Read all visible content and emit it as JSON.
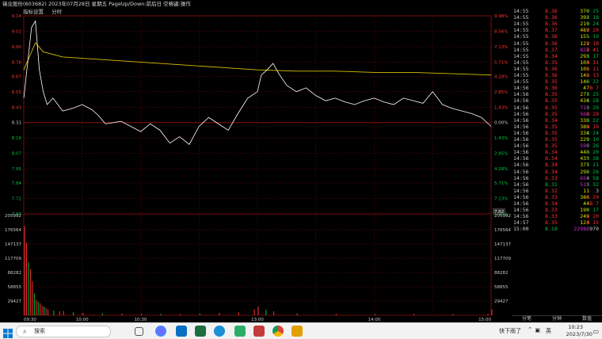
{
  "window": {
    "title": "锡业股份(603682)  2023年07月28日 星期五 PageUp/Down:前后日 空格键:操作"
  },
  "subbar": {
    "tab1": "指标设置",
    "tab2": "分时"
  },
  "colors": {
    "bg": "#000000",
    "up": "#ff3030",
    "down": "#00c040",
    "price_line": "#ffffff",
    "avg_line": "#d8c000",
    "grid": "#8a1010",
    "purple": "#d030d0"
  },
  "chart_data": [
    {
      "type": "line",
      "title": "",
      "xlabel": "",
      "ylabel": "",
      "x_ticks": [
        "09:30",
        "10:00",
        "10:30",
        "13:00",
        "14:00",
        "15:00"
      ],
      "y_left_ticks": [
        "9.14",
        "9.02",
        "8.90",
        "8.78",
        "8.67",
        "8.55",
        "8.43",
        "8.31",
        "8.19",
        "8.07",
        "7.95",
        "7.84",
        "7.72",
        "7.60"
      ],
      "y_right_ticks": [
        "9.98%",
        "8.56%",
        "7.13%",
        "5.71%",
        "4.28%",
        "2.85%",
        "1.43%",
        "0.00%",
        "1.43%",
        "2.85%",
        "4.28%",
        "5.71%",
        "7.13%",
        "8.56%"
      ],
      "prev_close": 8.31,
      "current_price_tag": "7.62",
      "ylim": [
        7.6,
        9.14
      ],
      "series": [
        {
          "name": "",
          "x": [
            0,
            4,
            6,
            8,
            10,
            12,
            15,
            20,
            25,
            30,
            35,
            38,
            42,
            46,
            50,
            55,
            60,
            65,
            70,
            75,
            80,
            85,
            90,
            95,
            100,
            105,
            110,
            115,
            120,
            122,
            125,
            128,
            131,
            135,
            140,
            145,
            150,
            155,
            160,
            165,
            170,
            175,
            180,
            185,
            190,
            195,
            200,
            205,
            210,
            215,
            220,
            225,
            230,
            235,
            240
          ],
          "values": [
            8.5,
            9.05,
            9.1,
            8.72,
            8.55,
            8.45,
            8.5,
            8.4,
            8.42,
            8.45,
            8.41,
            8.37,
            8.3,
            8.31,
            8.32,
            8.28,
            8.24,
            8.3,
            8.25,
            8.15,
            8.2,
            8.14,
            8.28,
            8.35,
            8.3,
            8.25,
            8.38,
            8.5,
            8.55,
            8.68,
            8.72,
            8.77,
            8.69,
            8.6,
            8.55,
            8.58,
            8.52,
            8.48,
            8.5,
            8.47,
            8.45,
            8.48,
            8.5,
            8.47,
            8.45,
            8.5,
            8.48,
            8.46,
            8.55,
            8.45,
            8.42,
            8.4,
            8.38,
            8.35,
            8.28
          ]
        },
        {
          "name": "",
          "x": [
            0,
            6,
            10,
            20,
            40,
            60,
            80,
            100,
            120,
            140,
            160,
            180,
            200,
            220,
            240
          ],
          "values": [
            8.72,
            8.93,
            8.86,
            8.82,
            8.8,
            8.78,
            8.76,
            8.74,
            8.72,
            8.71,
            8.71,
            8.7,
            8.7,
            8.69,
            8.68
          ]
        }
      ]
    },
    {
      "type": "bar",
      "title": "",
      "y_left_ticks": [
        "205992",
        "176564",
        "147137",
        "117709",
        "88282",
        "58855",
        "29427"
      ],
      "y_right_ticks": [
        "205992",
        "176564",
        "147137",
        "117709",
        "88282",
        "58855",
        "29427"
      ],
      "ylim": [
        0,
        205992
      ],
      "x": [
        0,
        1,
        2,
        3,
        4,
        5,
        6,
        7,
        8,
        9,
        10,
        11,
        12,
        15,
        18,
        20,
        25,
        30,
        40,
        50,
        60,
        70,
        80,
        90,
        100,
        110,
        118,
        120,
        124,
        128,
        140,
        160,
        180,
        200,
        220,
        238,
        240
      ],
      "values": [
        184000,
        150000,
        110000,
        95000,
        70000,
        45000,
        32000,
        28000,
        25000,
        20000,
        18000,
        15000,
        12000,
        10000,
        8000,
        9000,
        6000,
        5000,
        4000,
        3500,
        3000,
        3000,
        2800,
        3500,
        5000,
        6000,
        12000,
        18000,
        11000,
        8000,
        4000,
        3000,
        2500,
        3000,
        2500,
        3000,
        12000
      ],
      "bar_colors": [
        "up",
        "up",
        "down",
        "up",
        "up",
        "down",
        "up",
        "down",
        "up",
        "up",
        "down",
        "up",
        "up",
        "down",
        "up",
        "up",
        "down",
        "up",
        "down",
        "up",
        "up",
        "down",
        "up",
        "down",
        "up",
        "up",
        "up",
        "up",
        "down",
        "up",
        "down",
        "up",
        "down",
        "up",
        "down",
        "up",
        "up"
      ]
    }
  ],
  "trades": [
    {
      "t": "14:55",
      "p": "8.36",
      "v": "370",
      "d": "S",
      "n": "25",
      "pc": "up"
    },
    {
      "t": "14:55",
      "p": "8.36",
      "v": "392",
      "d": "S",
      "n": "18",
      "pc": "up"
    },
    {
      "t": "14:55",
      "p": "8.36",
      "v": "219",
      "d": "S",
      "n": "24",
      "pc": "up"
    },
    {
      "t": "14:55",
      "p": "8.37",
      "v": "487",
      "d": "B",
      "n": "20",
      "pc": "up"
    },
    {
      "t": "14:55",
      "p": "8.36",
      "v": "155",
      "d": "S",
      "n": "19",
      "pc": "up"
    },
    {
      "t": "14:55",
      "p": "8.36",
      "v": "127",
      "d": "B",
      "n": "18",
      "pc": "up"
    },
    {
      "t": "14:55",
      "p": "8.37",
      "v": "837",
      "d": "B",
      "n": "41",
      "pc": "up",
      "vc": "purple"
    },
    {
      "t": "14:55",
      "p": "8.34",
      "v": "292",
      "d": "S",
      "n": "17",
      "pc": "up"
    },
    {
      "t": "14:55",
      "p": "8.35",
      "v": "103",
      "d": "B",
      "n": "11",
      "pc": "up"
    },
    {
      "t": "14:55",
      "p": "8.36",
      "v": "105",
      "d": "B",
      "n": "11",
      "pc": "up"
    },
    {
      "t": "14:55",
      "p": "8.36",
      "v": "145",
      "d": "B",
      "n": "13",
      "pc": "up"
    },
    {
      "t": "14:55",
      "p": "8.35",
      "v": "146",
      "d": "S",
      "n": "22",
      "pc": "up"
    },
    {
      "t": "14:56",
      "p": "8.36",
      "v": "47",
      "d": "B",
      "n": "7",
      "pc": "up"
    },
    {
      "t": "14:56",
      "p": "8.35",
      "v": "277",
      "d": "S",
      "n": "25",
      "pc": "up"
    },
    {
      "t": "14:56",
      "p": "8.35",
      "v": "434",
      "d": "S",
      "n": "28",
      "pc": "up"
    },
    {
      "t": "14:56",
      "p": "8.35",
      "v": "719",
      "d": "S",
      "n": "29",
      "pc": "up",
      "vc": "purple"
    },
    {
      "t": "14:56",
      "p": "8.35",
      "v": "568",
      "d": "B",
      "n": "28",
      "pc": "up",
      "vc": "purple"
    },
    {
      "t": "14:56",
      "p": "8.34",
      "v": "338",
      "d": "S",
      "n": "22",
      "pc": "up"
    },
    {
      "t": "14:56",
      "p": "8.35",
      "v": "389",
      "d": "B",
      "n": "19",
      "pc": "up"
    },
    {
      "t": "14:56",
      "p": "8.35",
      "v": "334",
      "d": "S",
      "n": "24",
      "pc": "up"
    },
    {
      "t": "14:56",
      "p": "8.35",
      "v": "229",
      "d": "S",
      "n": "10",
      "pc": "up"
    },
    {
      "t": "14:56",
      "p": "8.35",
      "v": "590",
      "d": "S",
      "n": "26",
      "pc": "up",
      "vc": "purple"
    },
    {
      "t": "14:56",
      "p": "8.34",
      "v": "448",
      "d": "S",
      "n": "20",
      "pc": "up"
    },
    {
      "t": "14:56",
      "p": "8.34",
      "v": "433",
      "d": "S",
      "n": "38",
      "pc": "up"
    },
    {
      "t": "14:56",
      "p": "8.34",
      "v": "377",
      "d": "S",
      "n": "21",
      "pc": "up"
    },
    {
      "t": "14:56",
      "p": "8.34",
      "v": "298",
      "d": "S",
      "n": "26",
      "pc": "up"
    },
    {
      "t": "14:56",
      "p": "8.33",
      "v": "654",
      "d": "S",
      "n": "58",
      "pc": "up",
      "vc": "purple"
    },
    {
      "t": "14:56",
      "p": "8.31",
      "v": "512",
      "d": "S",
      "n": "32",
      "pc": "down",
      "vc": "purple"
    },
    {
      "t": "14:56",
      "p": "8.32",
      "v": "11",
      "d": "",
      "n": "3",
      "pc": "up"
    },
    {
      "t": "14:56",
      "p": "8.33",
      "v": "386",
      "d": "B",
      "n": "29",
      "pc": "up"
    },
    {
      "t": "14:56",
      "p": "8.34",
      "v": "44",
      "d": "B",
      "n": "7",
      "pc": "up"
    },
    {
      "t": "14:56",
      "p": "8.33",
      "v": "190",
      "d": "S",
      "n": "17",
      "pc": "up"
    },
    {
      "t": "14:56",
      "p": "8.33",
      "v": "249",
      "d": "B",
      "n": "20",
      "pc": "up"
    },
    {
      "t": "14:57",
      "p": "8.35",
      "v": "123",
      "d": "B",
      "n": "15",
      "pc": "up"
    },
    {
      "t": "15:00",
      "p": "8.19",
      "v": "22988",
      "d": "",
      "n": "970",
      "pc": "down",
      "vc": "purple"
    }
  ],
  "tabs": {
    "t1": "分笔",
    "t2": "分钟",
    "t3": "数值"
  },
  "taskbar": {
    "search_placeholder": "搜索",
    "weather": "快下雨了",
    "ime": "英",
    "time": "10:23",
    "date": "2023/7/30"
  }
}
